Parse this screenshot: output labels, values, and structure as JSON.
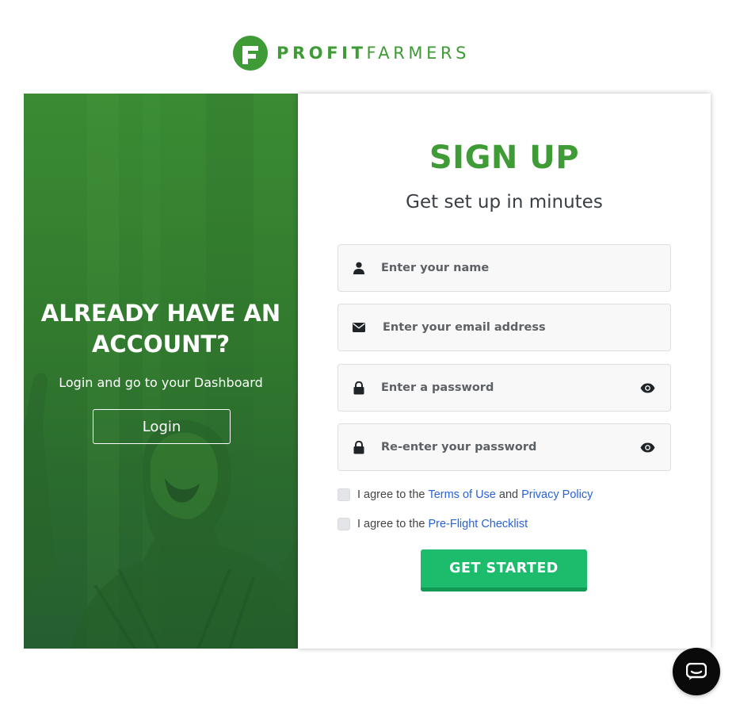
{
  "brand": {
    "name_bold": "PROFIT",
    "name_light": "FARMERS",
    "logo_icon": "profitfarmers-logo-icon",
    "color": "#3e9b35"
  },
  "left_panel": {
    "heading_line1": "ALREADY HAVE AN",
    "heading_line2": "ACCOUNT?",
    "subtitle": "Login and go to your Dashboard",
    "login_label": "Login"
  },
  "signup": {
    "title": "SIGN UP",
    "subtitle": "Get set up in minutes",
    "fields": {
      "name": {
        "placeholder": "Enter your name",
        "icon": "user-icon"
      },
      "email": {
        "placeholder": "Enter your email address",
        "icon": "envelope-icon"
      },
      "password": {
        "placeholder": "Enter a password",
        "icon": "lock-icon",
        "toggle_icon": "eye-icon"
      },
      "password_confirm": {
        "placeholder": "Re-enter your password",
        "icon": "lock-icon",
        "toggle_icon": "eye-icon"
      }
    },
    "terms": {
      "prefix": "I agree to the",
      "terms_link": "Terms of Use",
      "and": "and",
      "privacy_link": "Privacy Policy"
    },
    "checklist": {
      "prefix": "I agree to the",
      "link": "Pre-Flight Checklist"
    },
    "submit_label": "GET STARTED",
    "submit_color": "#1cbc6c",
    "link_color": "#2a63d4"
  },
  "chat": {
    "icon": "chat-bubble-icon"
  }
}
